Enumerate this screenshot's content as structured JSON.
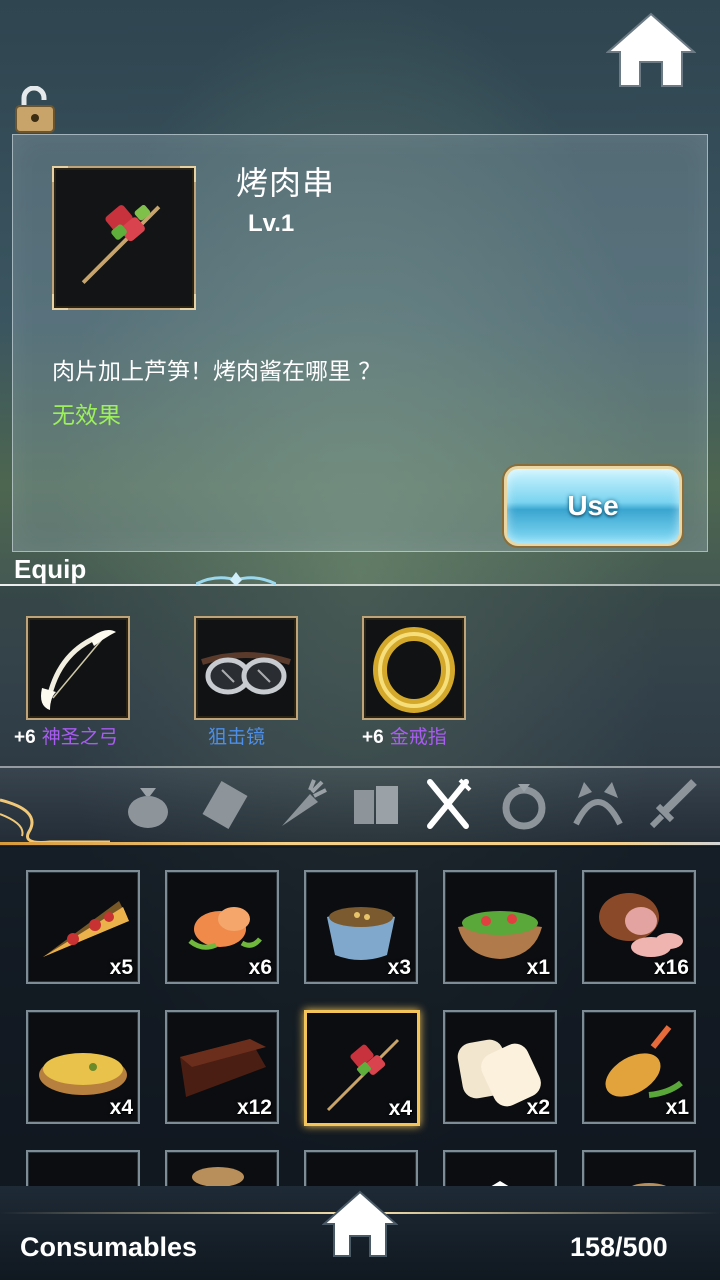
{
  "selected_item": {
    "name": "烤肉串",
    "level": "Lv.1",
    "description": "肉片加上芦笋！烤肉酱在哪里 ？",
    "effect": "无效果",
    "use_button": "Use",
    "icon": "meat-skewer-icon"
  },
  "equip": {
    "title": "Equip",
    "slots": [
      {
        "plus": "+6",
        "name": "神圣之弓",
        "color": "#a85cf0",
        "icon": "holy-bow-icon"
      },
      {
        "plus": "",
        "name": "狙击镜",
        "color": "#4d8ee8",
        "icon": "goggles-icon"
      },
      {
        "plus": "+6",
        "name": "金戒指",
        "color": "#a85cf0",
        "icon": "gold-ring-icon"
      }
    ]
  },
  "tabs": [
    {
      "name": "bag",
      "icon": "bag-icon",
      "active": false
    },
    {
      "name": "scroll",
      "icon": "scroll-icon",
      "active": false
    },
    {
      "name": "material",
      "icon": "carrot-icon",
      "active": false
    },
    {
      "name": "books",
      "icon": "books-icon",
      "active": false
    },
    {
      "name": "consumables",
      "icon": "fork-knife-icon",
      "active": true
    },
    {
      "name": "ring",
      "icon": "ring-icon",
      "active": false
    },
    {
      "name": "headgear",
      "icon": "cat-ears-icon",
      "active": false
    },
    {
      "name": "weapon",
      "icon": "sword-icon",
      "active": false
    }
  ],
  "inventory": {
    "items": [
      {
        "icon": "pizza-icon",
        "qty": "x5"
      },
      {
        "icon": "shrimp-icon",
        "qty": "x6"
      },
      {
        "icon": "soup-icon",
        "qty": "x3"
      },
      {
        "icon": "salad-icon",
        "qty": "x1"
      },
      {
        "icon": "ham-icon",
        "qty": "x16"
      },
      {
        "icon": "pie-icon",
        "qty": "x4"
      },
      {
        "icon": "chocolate-cake-icon",
        "qty": "x12"
      },
      {
        "icon": "meat-skewer-icon",
        "qty": "x4",
        "selected": true
      },
      {
        "icon": "bread-icon",
        "qty": "x2"
      },
      {
        "icon": "fried-shrimp-icon",
        "qty": "x1"
      },
      {
        "icon": "item-icon",
        "qty": ""
      },
      {
        "icon": "bread-bag-icon",
        "qty": ""
      },
      {
        "icon": "item-icon",
        "qty": ""
      },
      {
        "icon": "item-icon",
        "qty": ""
      },
      {
        "icon": "item-icon",
        "qty": ""
      }
    ]
  },
  "footer": {
    "category": "Consumables",
    "capacity": "158/500"
  },
  "colors": {
    "effect": "#9df05c",
    "selected_border": "#f3c45a",
    "frame_gold": "#bfa47a"
  }
}
